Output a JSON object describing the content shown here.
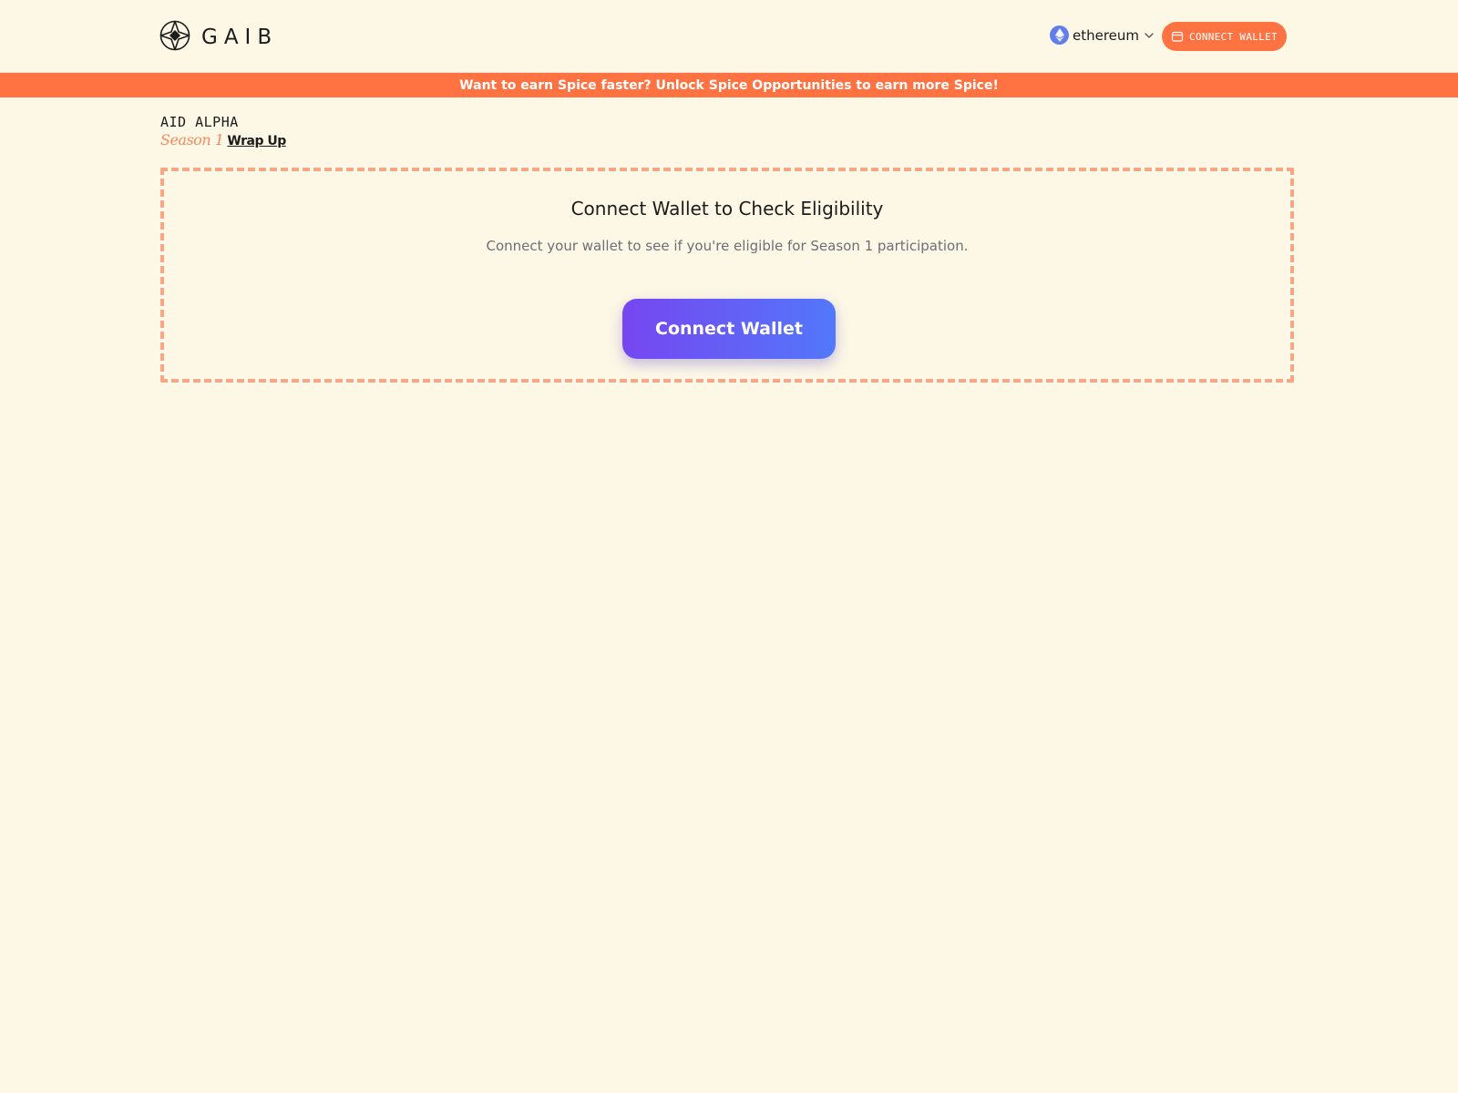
{
  "header": {
    "logo_text": "GAIB",
    "network": {
      "label": "ethereum",
      "icon": "ethereum-icon"
    },
    "connect_button": {
      "label": "CONNECT WALLET",
      "icon": "wallet-icon"
    }
  },
  "banner": {
    "text": "Want to earn Spice faster? Unlock Spice Opportunities to earn more Spice!"
  },
  "page": {
    "title": "AID ALPHA",
    "season": "Season 1",
    "wrap_up": "Wrap Up"
  },
  "card": {
    "title": "Connect Wallet to Check Eligibility",
    "description": "Connect your wallet to see if you're eligible for Season 1 participation.",
    "button_label": "Connect Wallet"
  },
  "colors": {
    "background": "#fdf7e6",
    "accent": "#ff7343",
    "button_gradient_start": "#7646f0",
    "button_gradient_end": "#5278fb",
    "card_border": "#f8a786"
  }
}
